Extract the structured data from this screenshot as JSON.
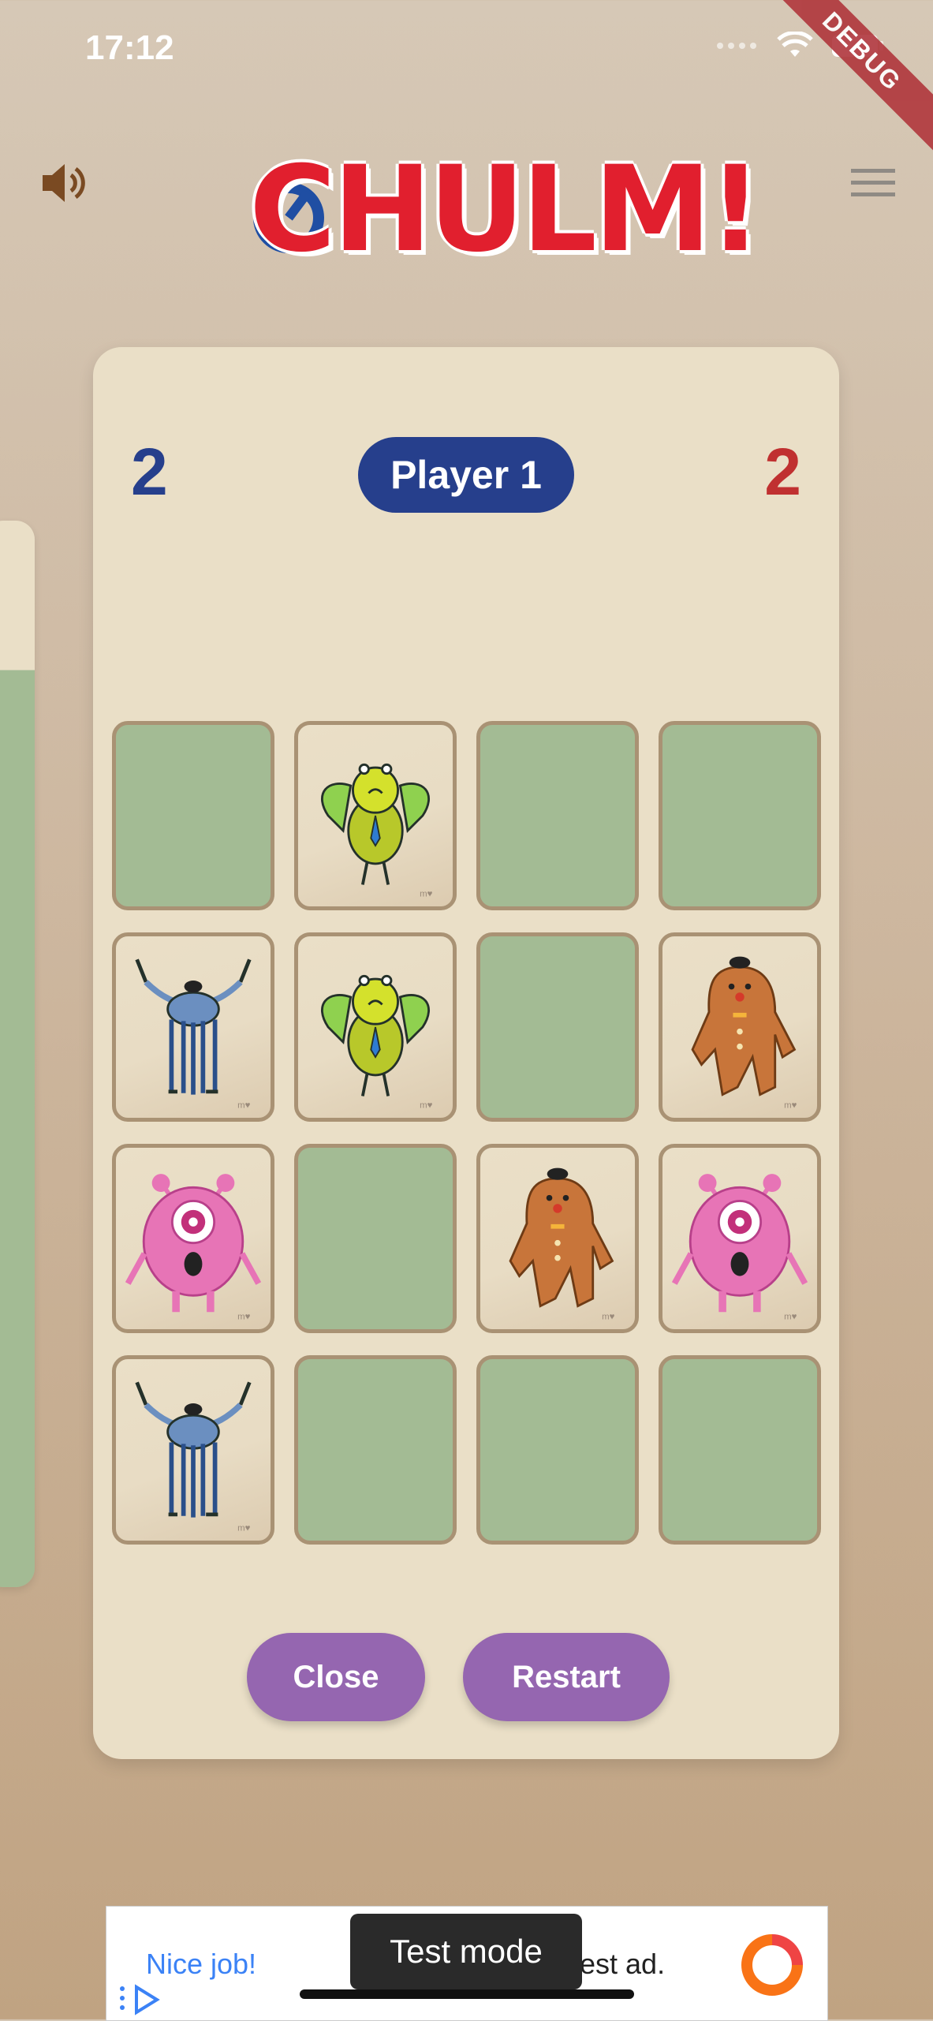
{
  "status": {
    "time": "17:12"
  },
  "debug_banner": "DEBUG",
  "header": {
    "logo_text": "CHULM!"
  },
  "scores": {
    "left": "2",
    "right": "2"
  },
  "turn": {
    "player_label": "Player 1"
  },
  "board": {
    "cards": [
      {
        "state": "hidden"
      },
      {
        "state": "faceup",
        "monster": "green-bird"
      },
      {
        "state": "hidden"
      },
      {
        "state": "hidden"
      },
      {
        "state": "faceup",
        "monster": "blue-octopus"
      },
      {
        "state": "faceup",
        "monster": "green-bird"
      },
      {
        "state": "hidden"
      },
      {
        "state": "faceup",
        "monster": "gingerbread"
      },
      {
        "state": "faceup",
        "monster": "pink-cyclops"
      },
      {
        "state": "hidden"
      },
      {
        "state": "faceup",
        "monster": "gingerbread"
      },
      {
        "state": "faceup",
        "monster": "pink-cyclops"
      },
      {
        "state": "faceup",
        "monster": "blue-octopus"
      },
      {
        "state": "hidden"
      },
      {
        "state": "hidden"
      },
      {
        "state": "hidden"
      }
    ]
  },
  "actions": {
    "close_label": "Close",
    "restart_label": "Restart"
  },
  "ad": {
    "title": "Nice job!",
    "text_partial": "est ad.",
    "test_mode_label": "Test mode"
  },
  "colors": {
    "blue": "#263f8c",
    "red": "#c03030",
    "button": "#9566b0",
    "card_back": "#a3bb94",
    "card_face": "#eadfc7"
  }
}
